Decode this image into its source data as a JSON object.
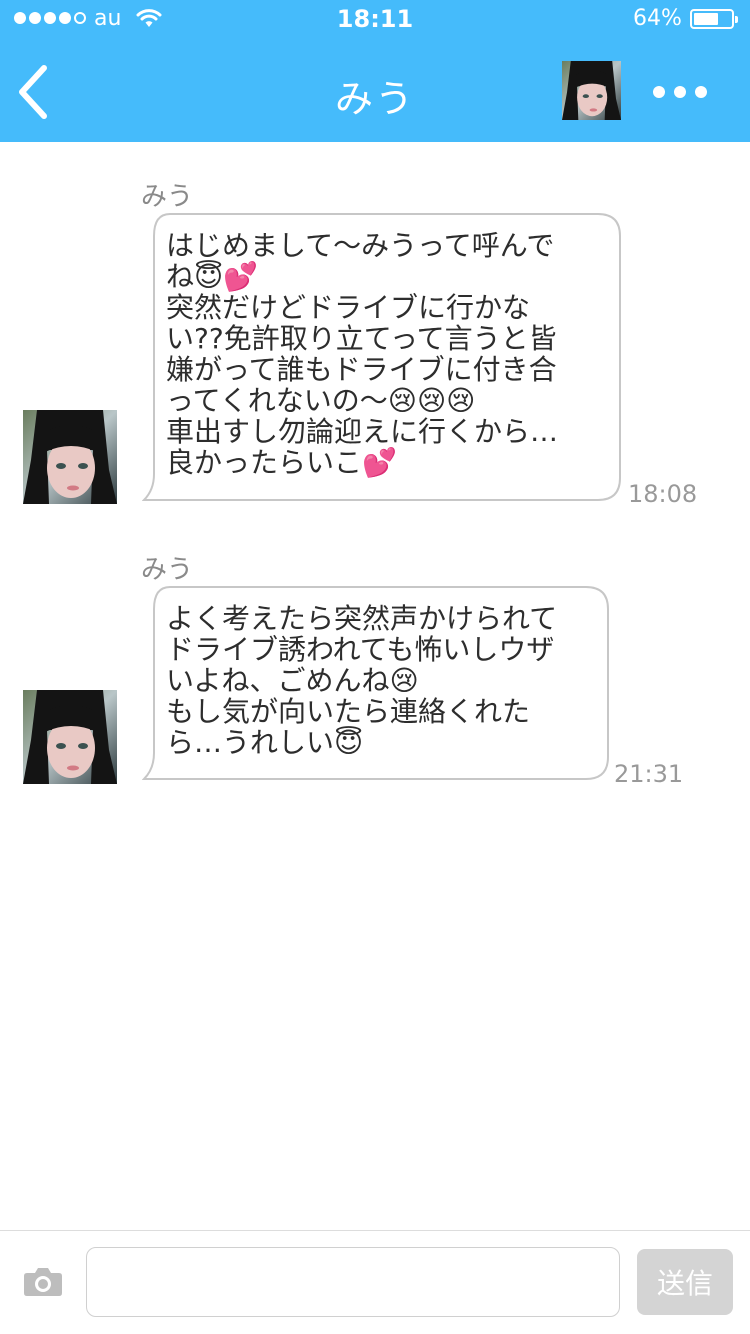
{
  "status_bar": {
    "carrier": "au",
    "time": "18:11",
    "battery_percent": "64%",
    "battery_level": 0.64,
    "signal_bars": 4
  },
  "nav": {
    "title": "みう",
    "back_icon": "chevron-left-icon",
    "more_icon": "more-dots-icon"
  },
  "messages": [
    {
      "sender": "みう",
      "lines": [
        "はじめまして〜みうって呼んで",
        "ね😇💕",
        "突然だけどドライブに行かな",
        "い??免許取り立てって言うと皆",
        "嫌がって誰もドライブに付き合",
        "ってくれないの〜😢😢😢",
        "車出すし勿論迎えに行くから…",
        "良かったらいこ💕"
      ],
      "time": "18:08"
    },
    {
      "sender": "みう",
      "lines": [
        "よく考えたら突然声かけられて",
        "ドライブ誘われても怖いしウザ",
        "いよね、ごめんね😢",
        "もし気が向いたら連絡くれた",
        "ら…うれしい😇"
      ],
      "time": "21:31"
    }
  ],
  "composer": {
    "placeholder": "",
    "send_label": "送信",
    "camera_icon": "camera-icon"
  },
  "colors": {
    "header": "#45bbfb",
    "send_disabled": "#d4d4d4"
  }
}
